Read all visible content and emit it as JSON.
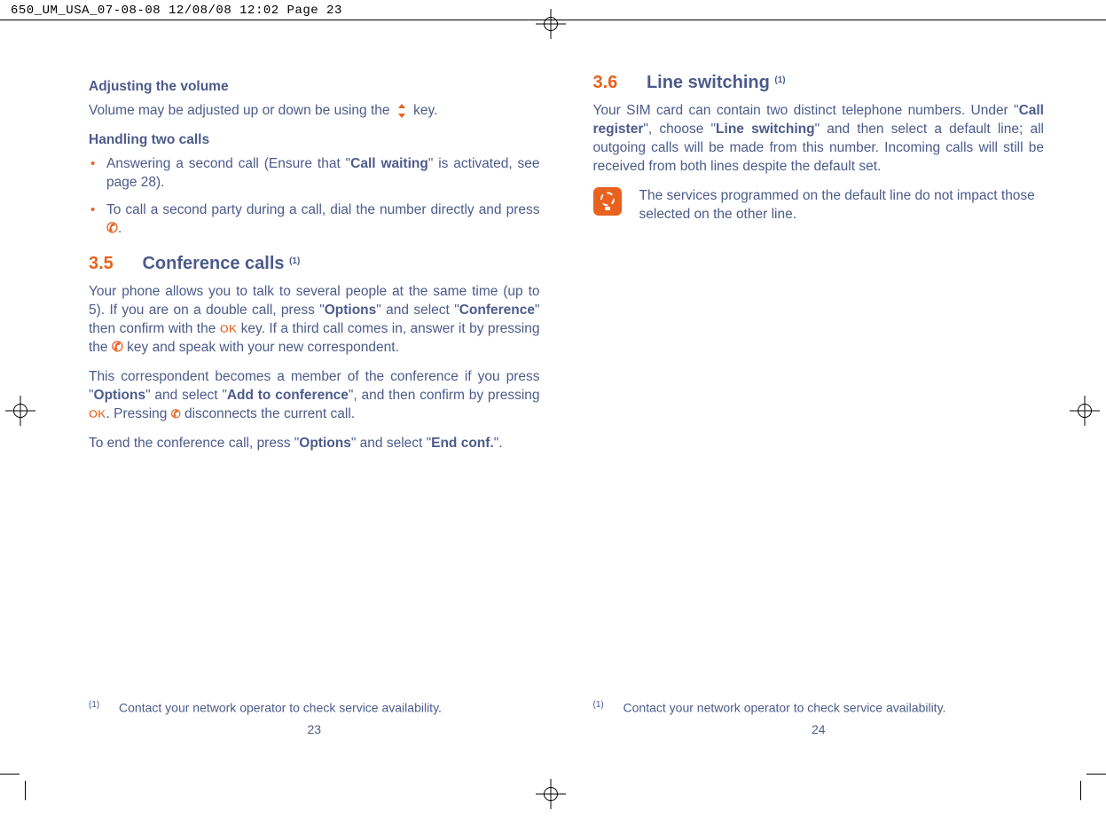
{
  "header": "650_UM_USA_07-08-08  12/08/08  12:02  Page 23",
  "left": {
    "h1": "Adjusting the volume",
    "p1_a": "Volume may be adjusted up or down be using the ",
    "p1_b": " key.",
    "h2": "Handling two calls",
    "bullets": [
      {
        "a": "Answering a second call (Ensure that \"",
        "bold": "Call waiting",
        "b": "\" is activated, see page 28)."
      },
      {
        "a": "To call a second party during a call, dial the number directly and press ",
        "icon": "phone",
        "b": "."
      }
    ],
    "sec_num": "3.5",
    "sec_title": "Conference calls ",
    "sec_sup": "(1)",
    "p2_a": "Your phone allows you to talk to several people at the same time (up to 5). If you are on a double call, press \"",
    "p2_b1": "Options",
    "p2_c": "\" and select \"",
    "p2_b2": "Conference",
    "p2_d": "\" then confirm with the ",
    "p2_e": " key. If a third call comes in, answer it by pressing the ",
    "p2_f": " key and speak with your new correspondent.",
    "p3_a": "This correspondent becomes a member of the conference if you press \"",
    "p3_b1": "Options",
    "p3_b": "\" and select \"",
    "p3_b2": "Add to conference",
    "p3_c": "\", and then confirm by pressing ",
    "p3_d": ". Pressing ",
    "p3_e": " disconnects the current call.",
    "p4_a": "To end the conference call, press \"",
    "p4_b1": "Options",
    "p4_b": "\" and select \"",
    "p4_b2": "End conf.",
    "p4_c": "\".",
    "footnote_sup": "(1)",
    "footnote": "Contact your network operator to check service availability.",
    "pagenum": "23"
  },
  "right": {
    "sec_num": "3.6",
    "sec_title": "Line switching ",
    "sec_sup": "(1)",
    "p1_a": "Your SIM card can contain two distinct telephone numbers. Under \"",
    "p1_b1": "Call register",
    "p1_b": "\", choose \"",
    "p1_b2": "Line switching",
    "p1_c": "\" and then select a default line; all outgoing calls will be made from this number. Incoming calls will still be received from both lines despite the default set.",
    "tip": "The services programmed on the default line do not impact those selected on the other line.",
    "footnote_sup": "(1)",
    "footnote": "Contact your network operator to check service availability.",
    "pagenum": "24"
  }
}
